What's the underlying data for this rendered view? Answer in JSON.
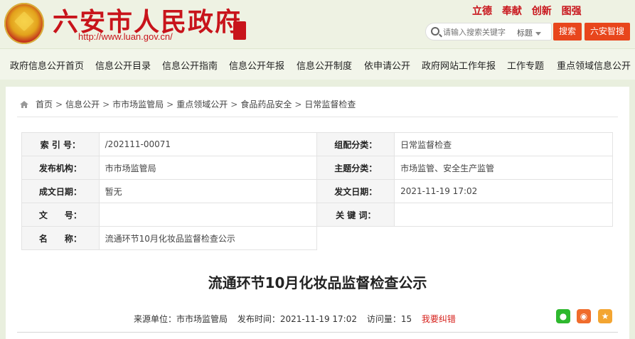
{
  "header": {
    "site_title": "六安市人民政府",
    "site_url": "http://www.luan.gov.cn/",
    "slogans": [
      "立德",
      "奉献",
      "创新",
      "图强"
    ],
    "search_placeholder": "请输入搜索关键字",
    "search_scope": "标题",
    "search_button": "搜索",
    "ai_button": "六安智搜"
  },
  "nav": {
    "items": [
      "政府信息公开首页",
      "信息公开目录",
      "信息公开指南",
      "信息公开年报",
      "信息公开制度",
      "依申请公开",
      "政府网站工作年报",
      "工作专题",
      "重点领域信息公开"
    ]
  },
  "breadcrumb": [
    "首页",
    "信息公开",
    "市市场监管局",
    "重点领域公开",
    "食品药品安全",
    "日常监督检查"
  ],
  "meta": {
    "index_label": "索 引 号：",
    "index_value": "/202111-00071",
    "category_label": "组配分类：",
    "category_value": "日常监督检查",
    "org_label": "发布机构：",
    "org_value": "市市场监管局",
    "topic_label": "主题分类：",
    "topic_value": "市场监管、安全生产监管",
    "created_label": "成文日期：",
    "created_value": "暂无",
    "issued_label": "发文日期：",
    "issued_value": "2021-11-19 17:02",
    "docno_label": "文　　号：",
    "docno_value": "",
    "keywords_label": "关 键 词：",
    "keywords_value": "",
    "name_label": "名　　称：",
    "name_value": "流通环节10月化妆品监督检查公示"
  },
  "article": {
    "title": "流通环节10月化妆品监督检查公示",
    "source": "来源单位：市市场监管局",
    "published": "发布时间：2021-11-19 17:02",
    "views": "访问量：15",
    "report": "我要纠错"
  },
  "colors": {
    "brand_red": "#c8141b",
    "button_orange": "#e8461c",
    "background": "#e9efde"
  }
}
